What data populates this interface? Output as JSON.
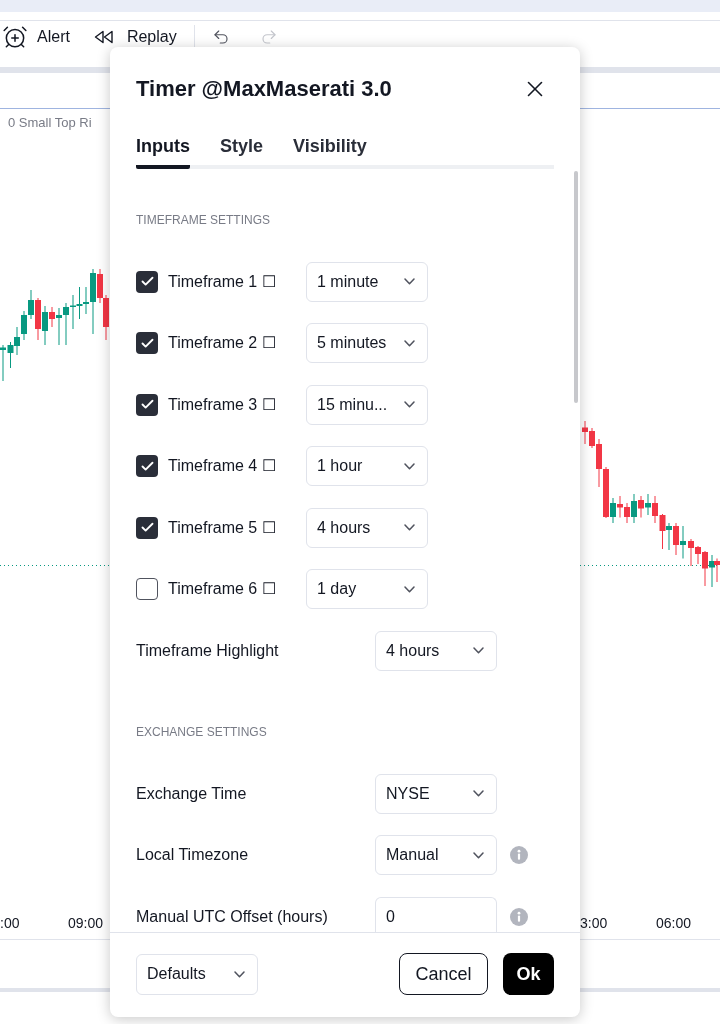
{
  "toolbar": {
    "items": [
      {
        "kind": "alert",
        "label": "Alert"
      },
      {
        "kind": "replay",
        "label": "Replay"
      },
      {
        "kind": "undo",
        "disabled": false
      },
      {
        "kind": "redo",
        "disabled": true
      }
    ]
  },
  "chart": {
    "legend": "0 Small Top Ri",
    "time_axis": [
      ":00",
      "09:00",
      "3:00",
      "06:00"
    ]
  },
  "dialog": {
    "title": "Timer @MaxMaserati 3.0",
    "tabs": [
      {
        "label": "Inputs",
        "selected": true
      },
      {
        "label": "Style",
        "selected": false
      },
      {
        "label": "Visibility",
        "selected": false
      }
    ],
    "sections": [
      {
        "heading": "TIMEFRAME SETTINGS",
        "rows": [
          {
            "kind": "check_select",
            "label": "Timeframe 1 ☐",
            "checked": true,
            "value": "1 minute"
          },
          {
            "kind": "check_select",
            "label": "Timeframe 2 ☐",
            "checked": true,
            "value": "5 minutes"
          },
          {
            "kind": "check_select",
            "label": "Timeframe 3 ☐",
            "checked": true,
            "value": "15 minu..."
          },
          {
            "kind": "check_select",
            "label": "Timeframe 4 ☐",
            "checked": true,
            "value": "1 hour"
          },
          {
            "kind": "check_select",
            "label": "Timeframe 5 ☐",
            "checked": true,
            "value": "4 hours"
          },
          {
            "kind": "check_select",
            "label": "Timeframe 6 ☐",
            "checked": false,
            "value": "1 day"
          },
          {
            "kind": "select",
            "label": "Timeframe Highlight",
            "value": "4 hours"
          }
        ]
      },
      {
        "heading": "EXCHANGE SETTINGS",
        "rows": [
          {
            "kind": "select",
            "label": "Exchange Time",
            "value": "NYSE"
          },
          {
            "kind": "select",
            "label": "Local Timezone",
            "value": "Manual",
            "info": true
          },
          {
            "kind": "input",
            "label": "Manual UTC Offset (hours)",
            "value": "0",
            "info": true
          }
        ]
      }
    ],
    "footer": {
      "preset": "Defaults",
      "buttons": [
        {
          "kind": "secondary",
          "label": "Cancel"
        },
        {
          "kind": "primary",
          "label": "Ok"
        }
      ]
    }
  }
}
